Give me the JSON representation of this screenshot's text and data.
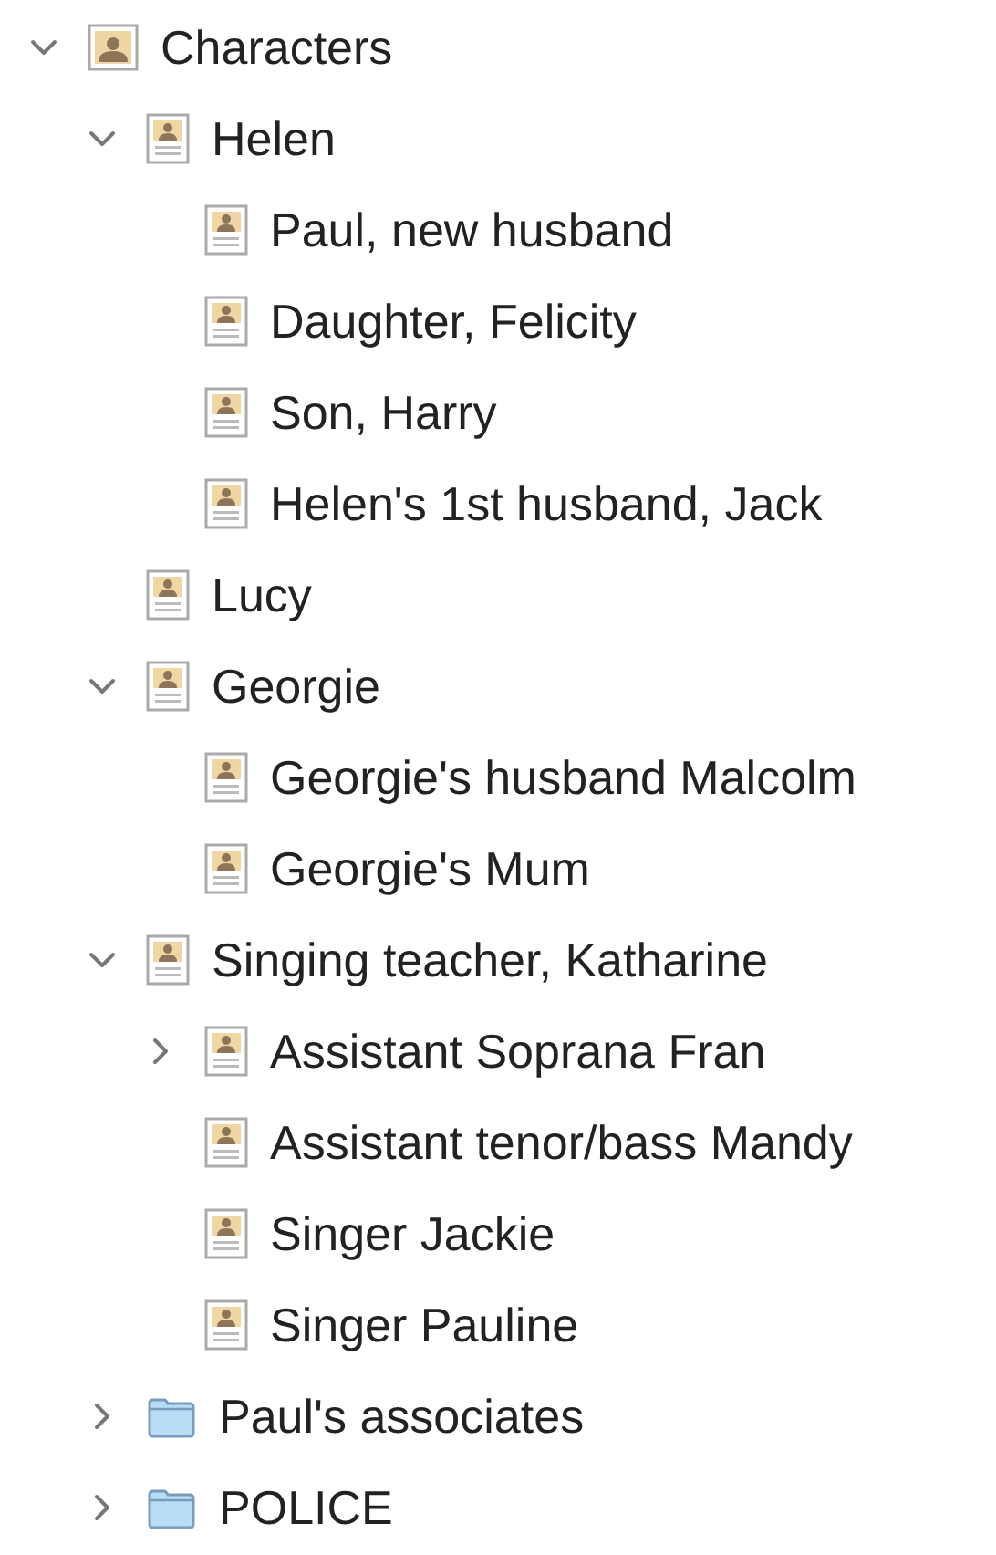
{
  "tree": [
    {
      "label": "Characters",
      "kind": "group",
      "expanded": true,
      "children": [
        {
          "label": "Helen",
          "kind": "sheet",
          "expanded": true,
          "children": [
            {
              "label": "Paul, new husband",
              "kind": "sheet"
            },
            {
              "label": "Daughter, Felicity",
              "kind": "sheet"
            },
            {
              "label": "Son, Harry",
              "kind": "sheet"
            },
            {
              "label": "Helen's 1st husband, Jack",
              "kind": "sheet"
            }
          ]
        },
        {
          "label": "Lucy",
          "kind": "sheet"
        },
        {
          "label": "Georgie",
          "kind": "sheet",
          "expanded": true,
          "children": [
            {
              "label": "Georgie's husband Malcolm",
              "kind": "sheet"
            },
            {
              "label": "Georgie's Mum",
              "kind": "sheet"
            }
          ]
        },
        {
          "label": "Singing teacher, Katharine",
          "kind": "sheet",
          "expanded": true,
          "children": [
            {
              "label": "Assistant Soprana Fran",
              "kind": "sheet",
              "expanded": false
            },
            {
              "label": "Assistant tenor/bass Mandy",
              "kind": "sheet"
            },
            {
              "label": "Singer Jackie",
              "kind": "sheet"
            },
            {
              "label": "Singer Pauline",
              "kind": "sheet"
            }
          ]
        },
        {
          "label": "Paul's associates",
          "kind": "folder",
          "expanded": false
        },
        {
          "label": "POLICE",
          "kind": "folder",
          "expanded": false
        }
      ]
    }
  ]
}
